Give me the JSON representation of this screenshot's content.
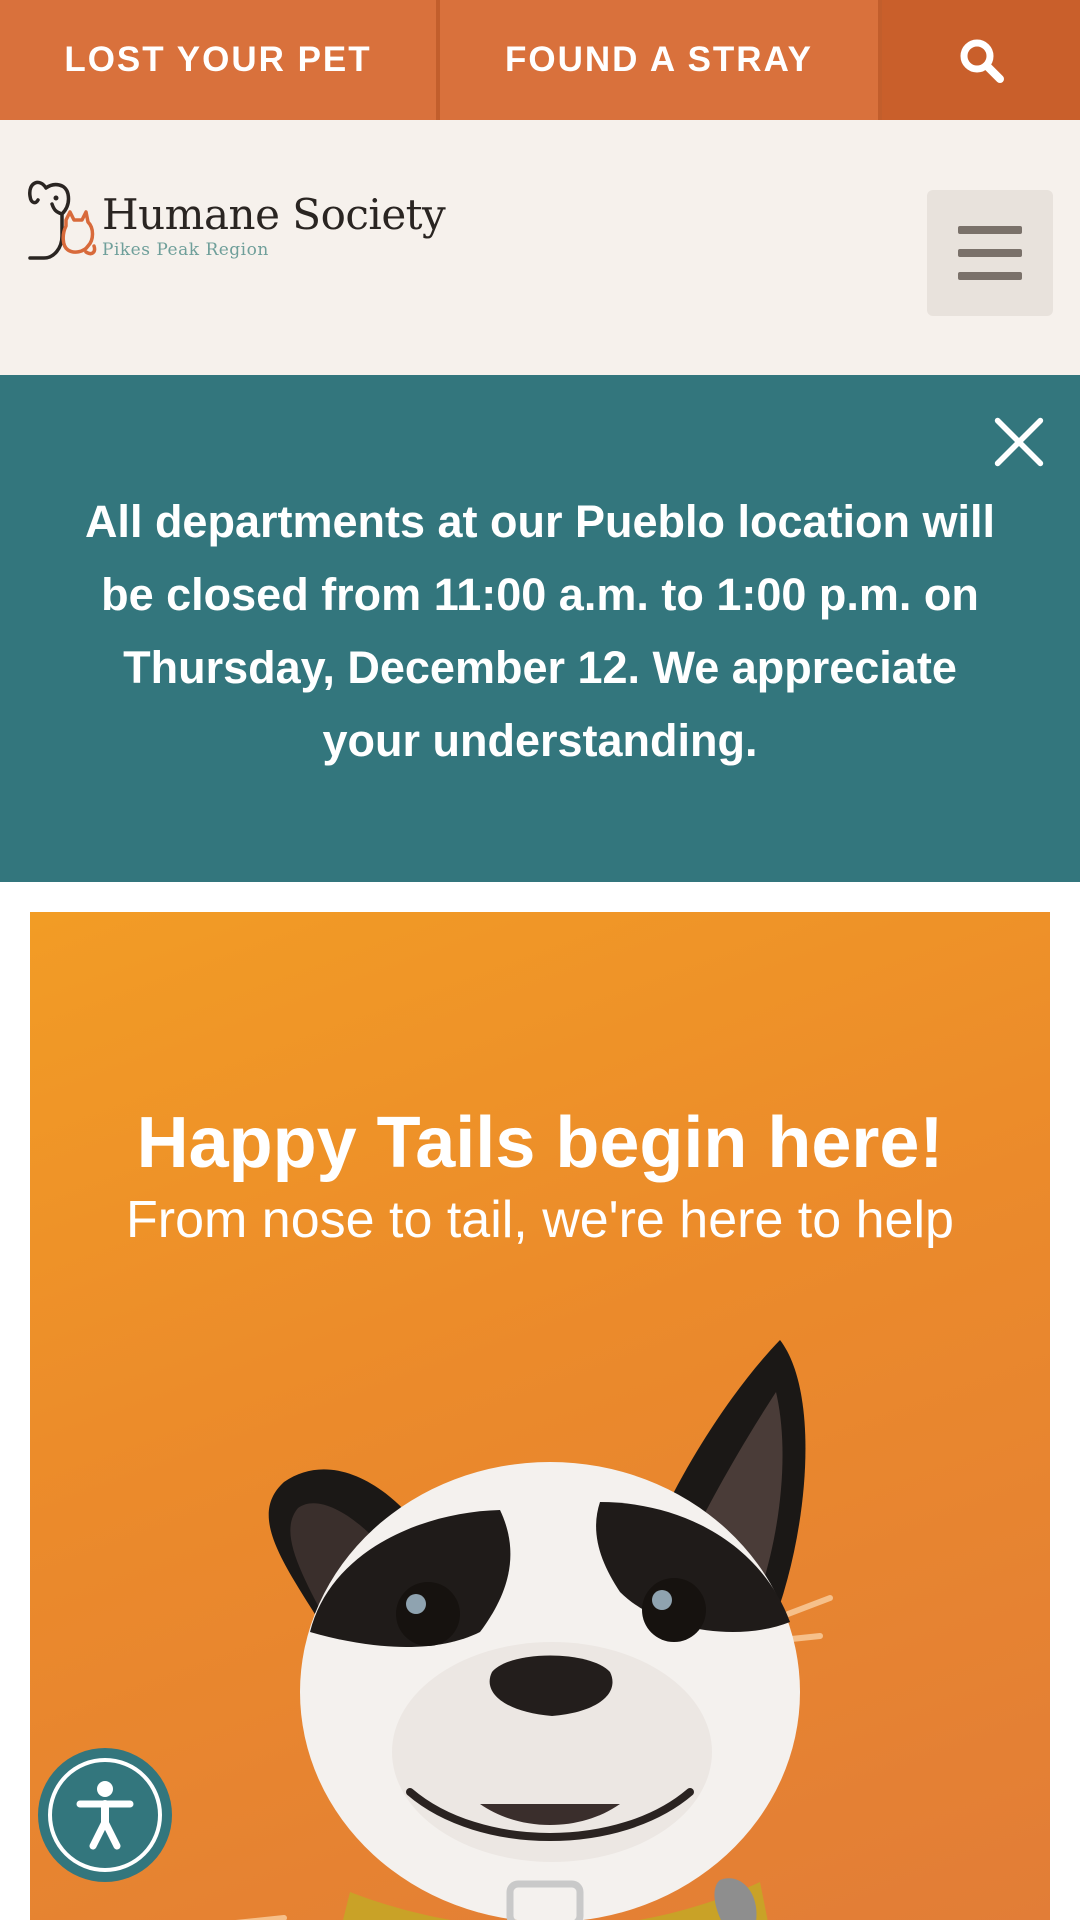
{
  "topbar": {
    "lost_label": "LOST YOUR PET",
    "found_label": "FOUND A STRAY",
    "search_icon": "search-icon"
  },
  "header": {
    "logo_title": "Humane Society",
    "logo_subtitle": "Pikes Peak Region",
    "menu_icon": "hamburger-menu-icon"
  },
  "alert": {
    "message": "All departments at our Pueblo location will be closed from 11:00 a.m. to 1:00 p.m. on Thursday, December 12. We appreciate your understanding.",
    "close_icon": "close-icon"
  },
  "hero": {
    "title": "Happy Tails begin here!",
    "subtitle": "From nose to tail, we're here to help",
    "image": "boston-terrier-dog-photo"
  },
  "accessibility": {
    "icon": "accessibility-icon"
  },
  "colors": {
    "topbar": "#d9713c",
    "search_bg": "#c95f2b",
    "header_bg": "#f6f1ec",
    "alert_bg": "#33767d",
    "hero_gradient_start": "#f29c25",
    "hero_gradient_end": "#e27d37"
  }
}
